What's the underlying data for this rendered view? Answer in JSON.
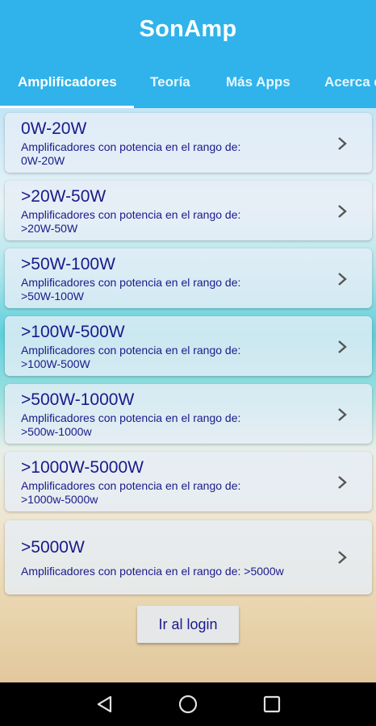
{
  "app": {
    "title": "SonAmp"
  },
  "tabs": [
    {
      "label": "Amplificadores"
    },
    {
      "label": "Teoría"
    },
    {
      "label": "Más Apps"
    },
    {
      "label": "Acerca d"
    }
  ],
  "items": [
    {
      "title": "0W-20W",
      "desc_line1": "Amplificadores con potencia en el rango de:",
      "desc_line2": "0W-20W"
    },
    {
      "title": ">20W-50W",
      "desc_line1": "Amplificadores con potencia en el rango de:",
      "desc_line2": ">20W-50W"
    },
    {
      "title": ">50W-100W",
      "desc_line1": "Amplificadores con potencia en el rango de:",
      "desc_line2": ">50W-100W"
    },
    {
      "title": ">100W-500W",
      "desc_line1": "Amplificadores con potencia en el rango de:",
      "desc_line2": ">100W-500W"
    },
    {
      "title": ">500W-1000W",
      "desc_line1": "Amplificadores con potencia en el rango de:",
      "desc_line2": ">500w-1000w"
    },
    {
      "title": ">1000W-5000W",
      "desc_line1": "Amplificadores con potencia en el rango de:",
      "desc_line2": ">1000w-5000w"
    },
    {
      "title": ">5000W",
      "desc_line1": "Amplificadores con potencia en el rango de: >5000w"
    }
  ],
  "login_button": {
    "label": "Ir al login"
  },
  "colors": {
    "appbar": "#2fb3ea",
    "text": "#1a1a8a",
    "card": "#e6eef6"
  },
  "icons": {
    "chevron": "chevron-right-icon",
    "nav_back": "back-triangle-icon",
    "nav_home": "home-circle-icon",
    "nav_recents": "recents-square-icon"
  }
}
